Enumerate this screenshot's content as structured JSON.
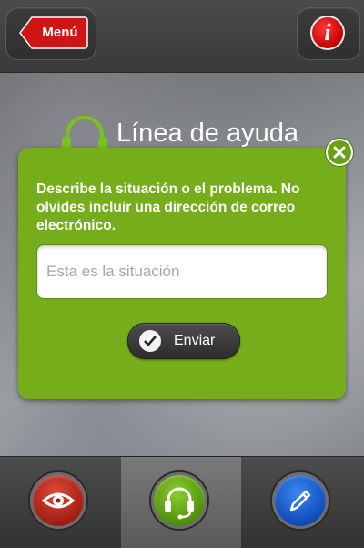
{
  "topbar": {
    "menu_label": "Menú",
    "info_label": "i"
  },
  "page": {
    "title": "Línea de ayuda"
  },
  "dialog": {
    "instructions": "Describe la situación o el problema. No olvides incluir una dirección de correo electrónico.",
    "input_placeholder": "Esta es la situación",
    "input_value": "",
    "send_label": "Enviar"
  },
  "tabbar": {
    "tabs": [
      {
        "icon": "eye-icon",
        "color": "#c0281a",
        "active": false
      },
      {
        "icon": "headset-icon",
        "color": "#6bb01c",
        "active": true
      },
      {
        "icon": "pencil-icon",
        "color": "#1d5fd4",
        "active": false
      }
    ]
  },
  "colors": {
    "accent_green": "#76ad1a",
    "menu_red": "#d01515"
  }
}
